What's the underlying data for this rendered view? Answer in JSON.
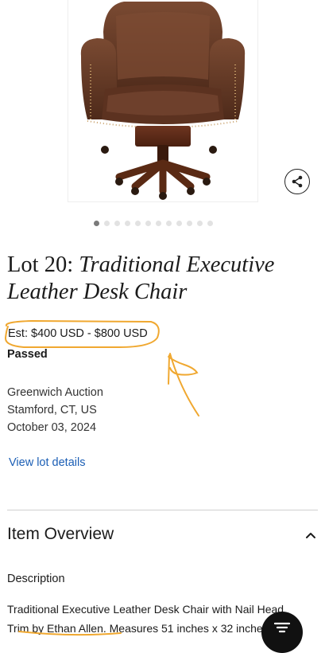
{
  "lot": {
    "number_label": "Lot 20:",
    "title": "Traditional Executive Leather Desk Chair",
    "estimate": "Est: $400 USD - $800 USD",
    "status": "Passed"
  },
  "auction_house": {
    "name": "Greenwich Auction",
    "location": "Stamford, CT, US",
    "date": "October 03, 2024"
  },
  "links": {
    "view_details": "View lot details"
  },
  "carousel": {
    "image_count": 12,
    "active_index": 0
  },
  "overview": {
    "heading": "Item Overview",
    "description_label": "Description",
    "description_lines": [
      "Traditional Executive Leather Desk Chair with Nail Head",
      "Trim by Ethan Allen. Measures 51 inches x 32 inches x 28"
    ]
  },
  "icons": {
    "share": "share-icon",
    "collapse": "chevron-up-icon",
    "menu": "filter-icon"
  },
  "colors": {
    "link": "#1c5fb5",
    "annotation": "#f0a830",
    "fab": "#111111"
  }
}
